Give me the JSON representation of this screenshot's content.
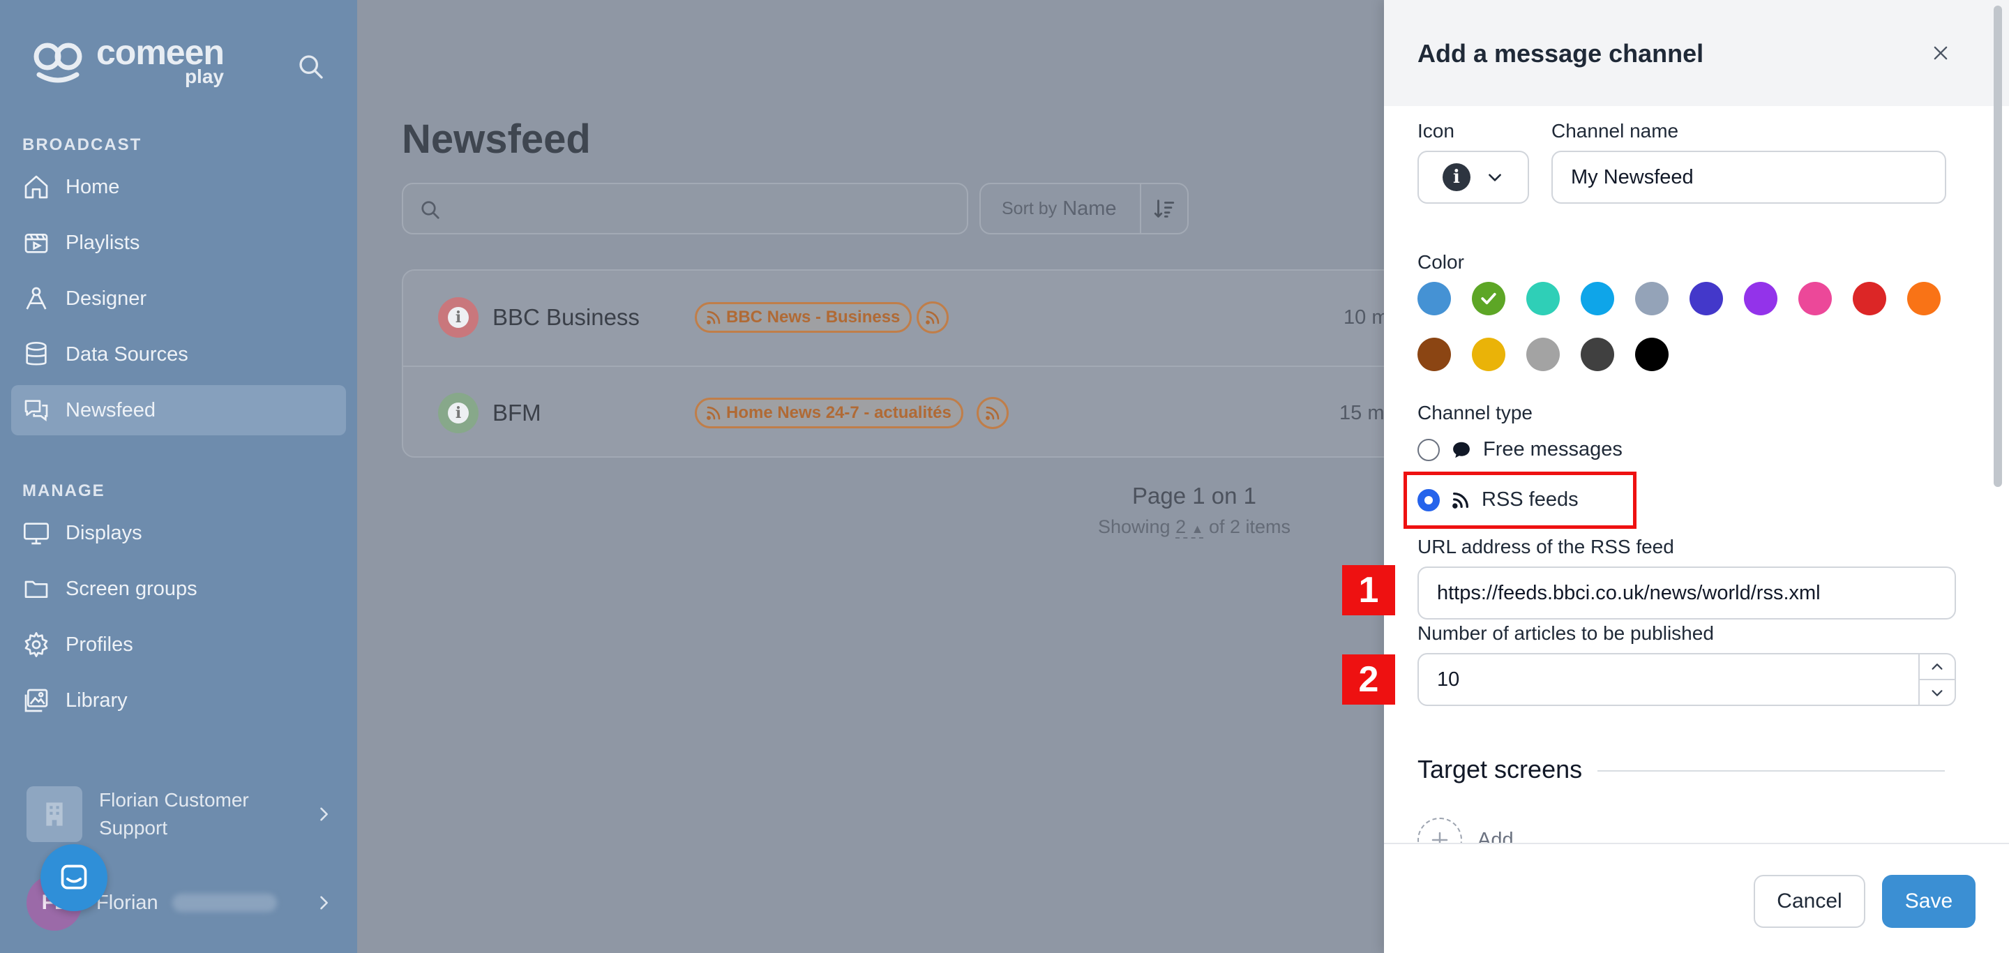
{
  "sidebar": {
    "logo": {
      "main": "comeen",
      "sub": "play"
    },
    "sections": {
      "broadcast": "BROADCAST",
      "manage": "MANAGE"
    },
    "items": [
      {
        "label": "Home",
        "icon": "home-icon"
      },
      {
        "label": "Playlists",
        "icon": "playlist-icon"
      },
      {
        "label": "Designer",
        "icon": "designer-icon"
      },
      {
        "label": "Data Sources",
        "icon": "database-icon"
      },
      {
        "label": "Newsfeed",
        "icon": "newsfeed-icon",
        "active": true
      },
      {
        "label": "Displays",
        "icon": "display-icon"
      },
      {
        "label": "Screen groups",
        "icon": "folder-icon"
      },
      {
        "label": "Profiles",
        "icon": "gear-icon"
      },
      {
        "label": "Library",
        "icon": "image-icon"
      }
    ],
    "org_name": "Florian Customer Support",
    "user": {
      "initials": "FL",
      "name": "Florian"
    }
  },
  "main": {
    "title": "Newsfeed",
    "search_placeholder": "",
    "sort": {
      "by_label": "Sort by",
      "value": "Name"
    },
    "rows": [
      {
        "name": "BBC Business",
        "tag": "BBC News - Business",
        "time": "10 m",
        "icon_color": "#c9777c"
      },
      {
        "name": "BFM",
        "tag": "Home News 24-7 - actualités",
        "time": "15 m",
        "icon_color": "#87a88a"
      }
    ],
    "pager": {
      "main": "Page 1 on 1",
      "prefix": "Showing",
      "count": "2",
      "suffix": "of 2 items"
    }
  },
  "drawer": {
    "title": "Add a message channel",
    "icon_label": "Icon",
    "channel_name_label": "Channel name",
    "channel_name_value": "My Newsfeed",
    "color_label": "Color",
    "colors": [
      "#4592d4",
      "#5da626",
      "#2fcfb7",
      "#0ea5e9",
      "#94a3b8",
      "#4338ca",
      "#9333ea",
      "#ec4899",
      "#dc2626",
      "#f97316",
      "#8b4513",
      "#eab308",
      "#a3a3a3",
      "#404040",
      "#000000"
    ],
    "selected_color_index": 1,
    "channel_type_label": "Channel type",
    "type_free": "Free messages",
    "type_rss": "RSS feeds",
    "rss_url_label": "URL address of the RSS feed",
    "rss_url_value": "https://feeds.bbci.co.uk/news/world/rss.xml",
    "articles_label": "Number of articles to be published",
    "articles_value": "10",
    "target_screens_label": "Target screens",
    "add_label": "Add",
    "cancel_label": "Cancel",
    "save_label": "Save"
  },
  "annotations": {
    "marker1": "1",
    "marker2": "2"
  }
}
